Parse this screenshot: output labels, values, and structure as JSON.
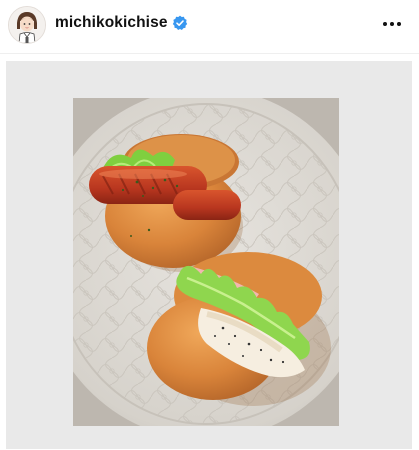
{
  "header": {
    "username": "michikokichise",
    "avatar_icon": "user-avatar-illustration",
    "verified_icon": "verified-badge-icon",
    "more_icon": "more-options-icon"
  },
  "post": {
    "image_subject": "sandwich-photo",
    "colors": {
      "post_background": "#e9e9e9",
      "verified_blue": "#3897f0",
      "plate": "#dcd8d2",
      "bun": "#d98a3e",
      "lettuce": "#8fd64e",
      "sausage": "#b8361f"
    }
  }
}
